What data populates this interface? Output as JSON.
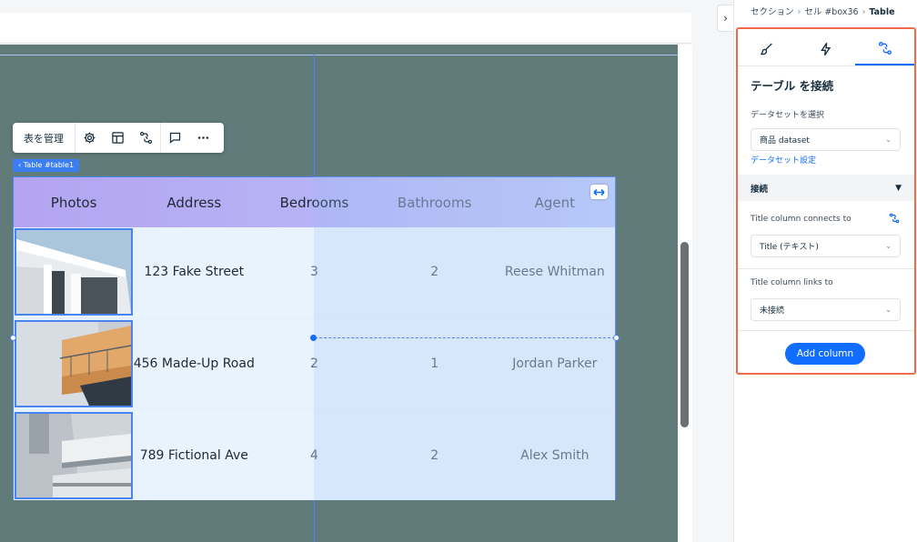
{
  "breadcrumb": {
    "items": [
      "セクション",
      "セル #box36",
      "Table"
    ]
  },
  "toolbar": {
    "manage_label": "表を管理"
  },
  "table_tag": {
    "label": "‹ Table #table1"
  },
  "table": {
    "headers": [
      "Photos",
      "Address",
      "Bedrooms",
      "Bathrooms",
      "Agent"
    ],
    "rows": [
      {
        "photo": "photo-building-1",
        "address": "123 Fake Street",
        "bedrooms": "3",
        "bathrooms": "2",
        "agent": "Reese Whitman"
      },
      {
        "photo": "photo-balcony",
        "address": "456 Made-Up Road",
        "bedrooms": "2",
        "bathrooms": "1",
        "agent": "Jordan Parker"
      },
      {
        "photo": "photo-building-2",
        "address": "789 Fictional Ave",
        "bedrooms": "4",
        "bathrooms": "2",
        "agent": "Alex Smith"
      }
    ]
  },
  "panel": {
    "tabs": [
      {
        "icon": "brush-icon"
      },
      {
        "icon": "lightning-icon"
      },
      {
        "icon": "connect-icon",
        "active": true
      }
    ],
    "title": "テーブル を接続",
    "dataset_label": "データセットを選択",
    "dataset_value": "商品 dataset",
    "dataset_settings_link": "データセット設定",
    "connect_section": "接続",
    "title_connects_label": "Title column connects to",
    "title_connects_value": "Title (テキスト)",
    "title_links_label": "Title column links to",
    "title_links_value": "未接続",
    "add_column_label": "Add column"
  },
  "colors": {
    "accent": "#116dff",
    "highlight": "#ef6a4a",
    "stage": "#617a7a",
    "selection": "#4a85ef"
  }
}
